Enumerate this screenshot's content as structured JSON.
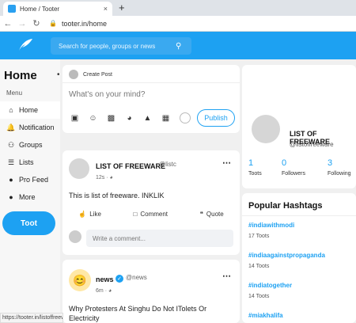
{
  "browser": {
    "tab_title": "Home / Tooter",
    "tab_close": "×",
    "new_tab": "+",
    "url": "tooter.in/home",
    "status_url": "https://tooter.in/listoffreeware"
  },
  "header": {
    "search_placeholder": "Search for people, groups or news",
    "brand_color": "#1da1f2"
  },
  "sidebar": {
    "title": "Home",
    "menu_label": "Menu",
    "items": [
      {
        "label": "Home",
        "icon": "home-icon",
        "active": true
      },
      {
        "label": "Notification",
        "icon": "bell-icon"
      },
      {
        "label": "Groups",
        "icon": "groups-icon"
      },
      {
        "label": "Lists",
        "icon": "list-icon"
      },
      {
        "label": "Pro Feed",
        "icon": "pro-feed-icon"
      },
      {
        "label": "More",
        "icon": "more-icon"
      }
    ],
    "toot_label": "Toot"
  },
  "compose": {
    "header": "Create Post",
    "placeholder": "What's on your mind?",
    "publish_label": "Publish"
  },
  "post1": {
    "author": "LIST OF FREEWARE",
    "handle": "@listc",
    "time": "12s",
    "text": "This is list of freeware. INKLIK",
    "like_label": "Like",
    "comment_label": "Comment",
    "quote_label": "Quote",
    "comment_placeholder": "Write a comment..."
  },
  "post2": {
    "author": "news",
    "handle": "@news",
    "time": "6m",
    "text": "Why Protesters At Singhu Do Not ITolets Or Electricity"
  },
  "profile": {
    "name": "LIST OF FREEWARE",
    "handle": "@listoffreeware",
    "stats": [
      {
        "value": "1",
        "label": "Toots"
      },
      {
        "value": "0",
        "label": "Followers"
      },
      {
        "value": "3",
        "label": "Following"
      }
    ]
  },
  "hashtags": {
    "title": "Popular Hashtags",
    "items": [
      {
        "tag": "#indiawithmodi",
        "count": "17 Toots"
      },
      {
        "tag": "#indiaagainstpropaganda",
        "count": "14 Toots"
      },
      {
        "tag": "#indiatogether",
        "count": "14 Toots"
      },
      {
        "tag": "#miakhalifa",
        "count": ""
      }
    ]
  }
}
